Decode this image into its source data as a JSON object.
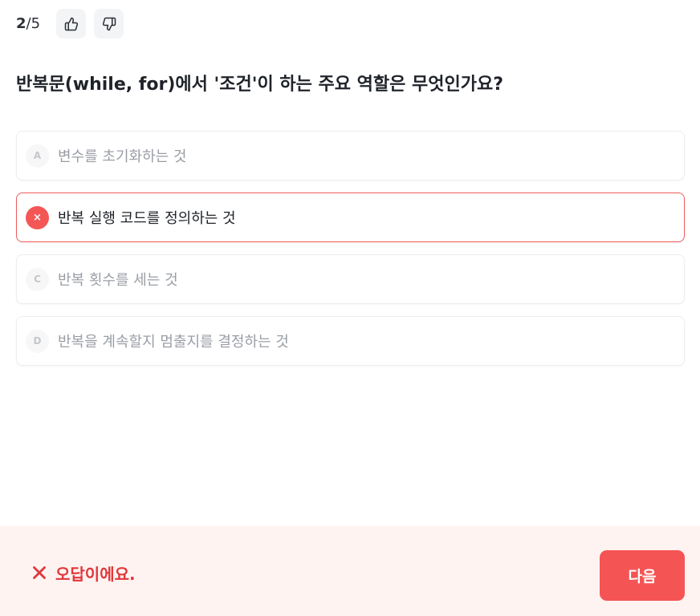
{
  "progress": {
    "current": "2",
    "separator": "/",
    "total": "5"
  },
  "feedback_buttons": {
    "like_icon": "thumbs-up-icon",
    "dislike_icon": "thumbs-down-icon"
  },
  "question": {
    "text": "반복문(while, for)에서 '조건'이 하는 주요 역할은 무엇인가요?"
  },
  "options": [
    {
      "marker": "A",
      "text": "변수를 초기화하는 것",
      "state": "default"
    },
    {
      "marker": "×",
      "text": "반복 실행 코드를 정의하는 것",
      "state": "wrong-selected"
    },
    {
      "marker": "C",
      "text": "반복 횟수를 세는 것",
      "state": "default"
    },
    {
      "marker": "D",
      "text": "반복을 계속할지 멈출지를 결정하는 것",
      "state": "default"
    }
  ],
  "result": {
    "icon": "x-icon",
    "message": "오답이에요.",
    "next_label": "다음"
  },
  "colors": {
    "error": "#e0383a",
    "next_button": "#f55454",
    "footer_bg": "#fff3f2",
    "wrong_border": "#ee5a5a"
  }
}
